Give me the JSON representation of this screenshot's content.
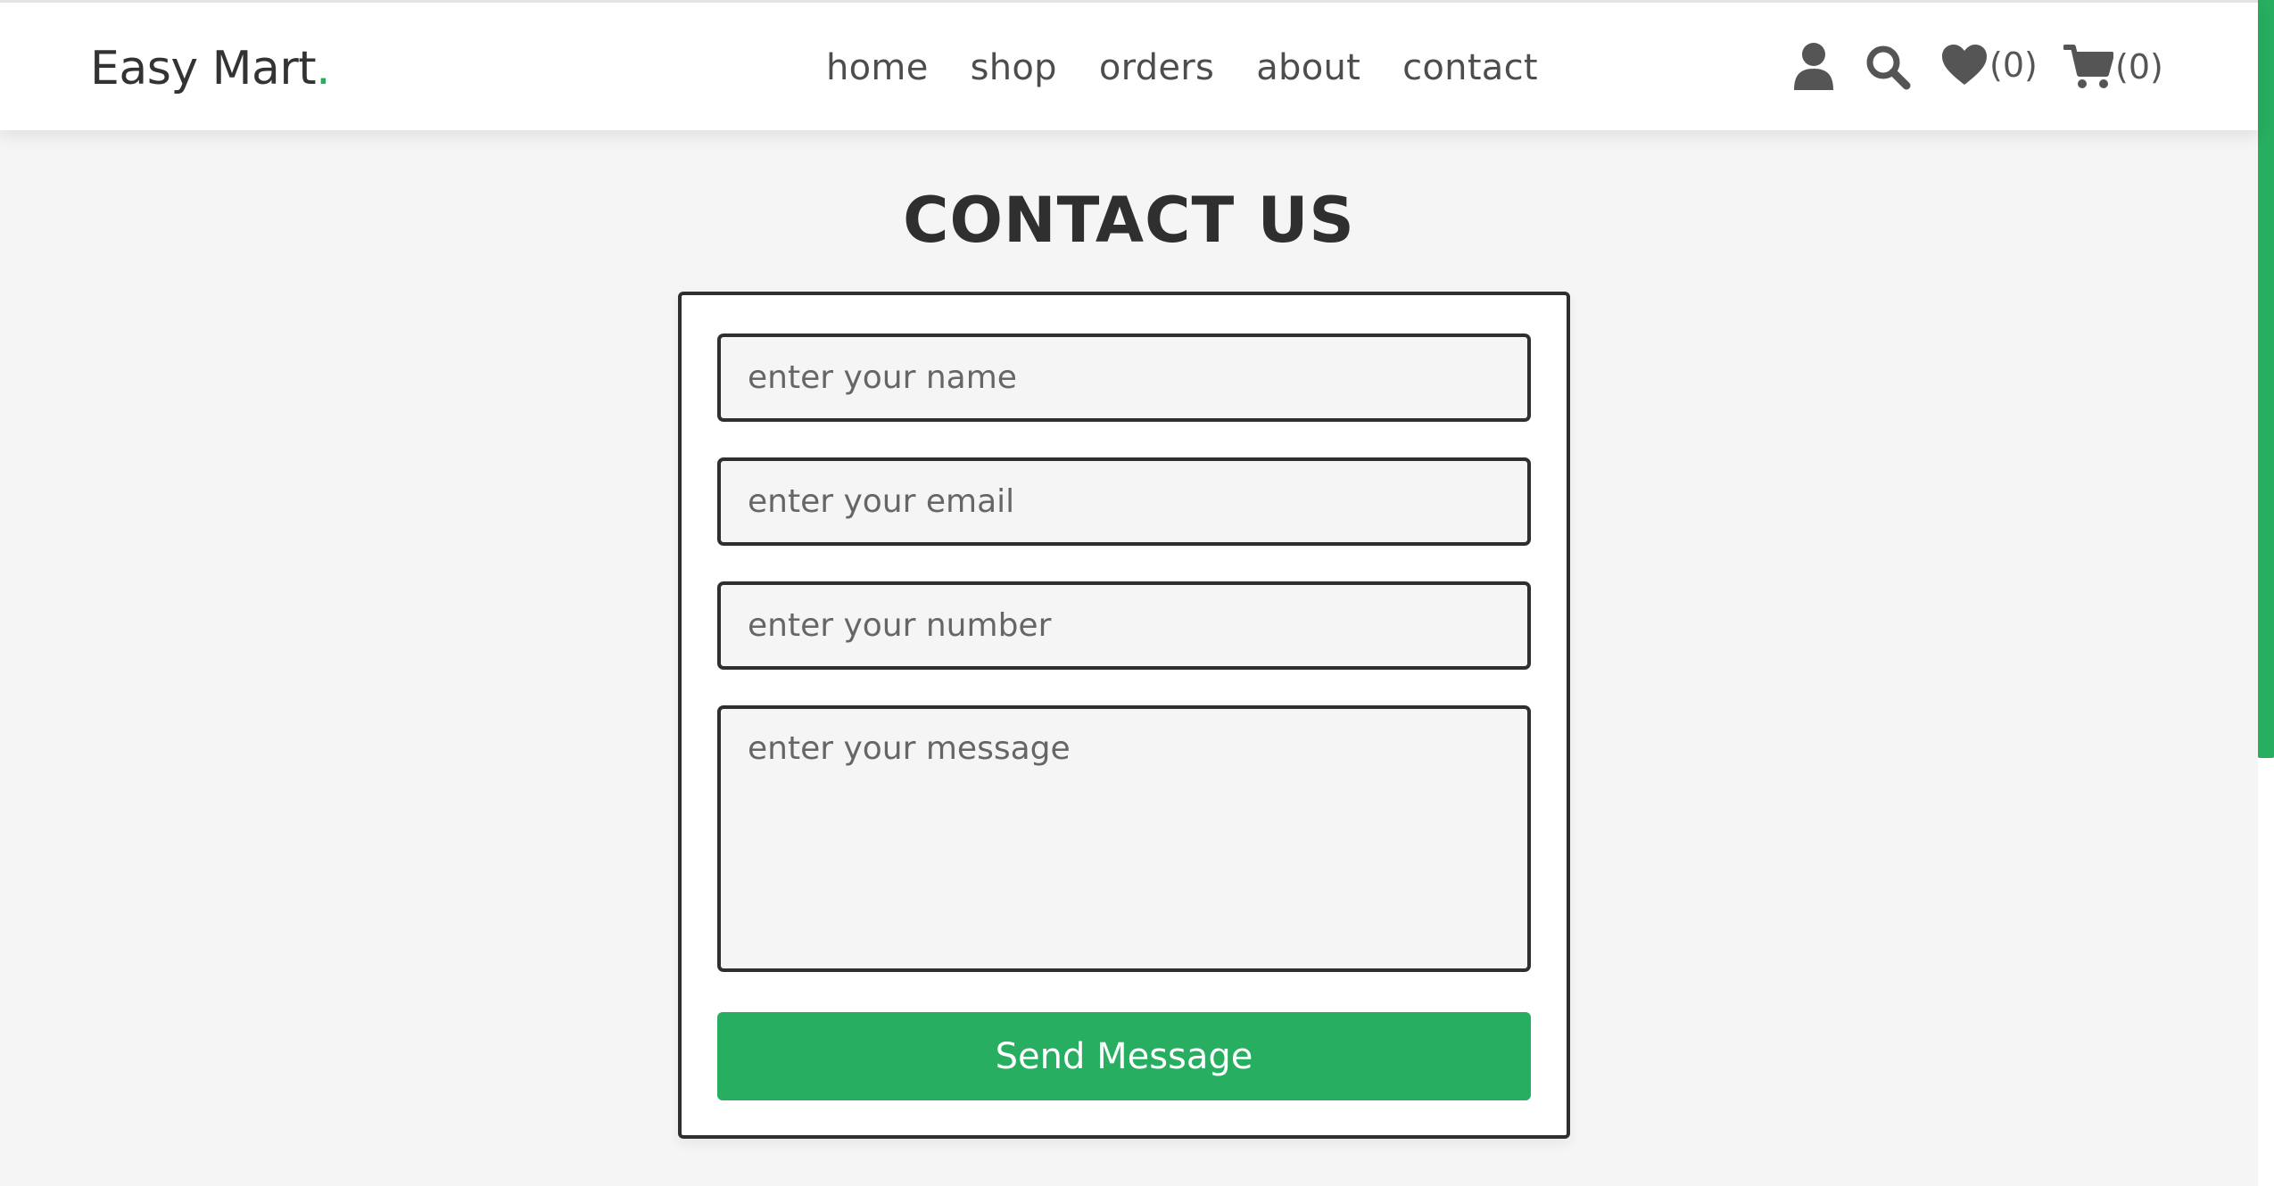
{
  "brand": {
    "name": "Easy Mart",
    "dot": "."
  },
  "nav": {
    "items": [
      {
        "label": "home"
      },
      {
        "label": "shop"
      },
      {
        "label": "orders"
      },
      {
        "label": "about"
      },
      {
        "label": "contact"
      }
    ]
  },
  "header_icons": {
    "user": "user-icon",
    "search": "search-icon",
    "wishlist": {
      "icon": "heart-icon",
      "count": "(0)"
    },
    "cart": {
      "icon": "cart-icon",
      "count": "(0)"
    }
  },
  "page": {
    "title": "CONTACT US"
  },
  "form": {
    "name_placeholder": "enter your name",
    "email_placeholder": "enter your email",
    "number_placeholder": "enter your number",
    "message_placeholder": "enter your message",
    "submit_label": "Send Message"
  },
  "colors": {
    "accent": "#27ae60",
    "text_dark": "#2f2f2f",
    "background": "#f5f5f5"
  }
}
